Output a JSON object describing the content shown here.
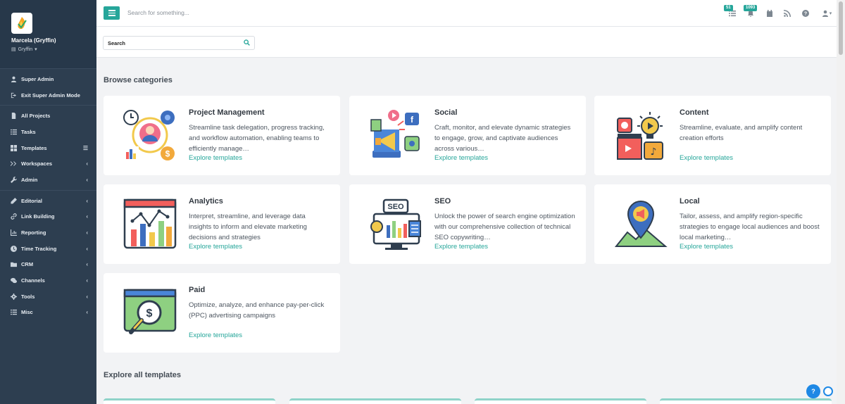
{
  "user": {
    "name": "Marcela (Gryffin)",
    "org": "Gryffin"
  },
  "sidebar": {
    "group1": [
      {
        "label": "Super Admin",
        "icon": "user-icon"
      },
      {
        "label": "Exit Super Admin Mode",
        "icon": "exit-icon"
      }
    ],
    "group2": [
      {
        "label": "All Projects",
        "icon": "file-icon"
      },
      {
        "label": "Tasks",
        "icon": "list-icon"
      },
      {
        "label": "Templates",
        "icon": "table-icon"
      },
      {
        "label": "Workspaces",
        "icon": "double-chevron-icon"
      },
      {
        "label": "Admin",
        "icon": "wrench-icon"
      }
    ],
    "group3": [
      {
        "label": "Editorial",
        "icon": "pencil-icon"
      },
      {
        "label": "Link Building",
        "icon": "link-icon"
      },
      {
        "label": "Reporting",
        "icon": "chart-icon"
      },
      {
        "label": "Time Tracking",
        "icon": "clock-icon"
      },
      {
        "label": "CRM",
        "icon": "folder-icon"
      },
      {
        "label": "Channels",
        "icon": "comments-icon"
      },
      {
        "label": "Tools",
        "icon": "cog-icon"
      },
      {
        "label": "Misc",
        "icon": "list-icon"
      }
    ]
  },
  "topbar": {
    "search_placeholder": "Search for something...",
    "tasks_badge": "51",
    "notifications_badge": "1093"
  },
  "search": {
    "label": "Search"
  },
  "main": {
    "browse_title": "Browse categories",
    "explore_title": "Explore all templates",
    "explore_link": "Explore templates",
    "categories": [
      {
        "title": "Project Management",
        "desc": "Streamline task delegation, progress tracking, and workflow automation, enabling teams to efficiently manage…"
      },
      {
        "title": "Social",
        "desc": "Craft, monitor, and elevate dynamic strategies to engage, grow, and captivate audiences across various…"
      },
      {
        "title": "Content",
        "desc": "Streamline, evaluate, and amplify content creation efforts"
      },
      {
        "title": "Analytics",
        "desc": "Interpret, streamline, and leverage data insights to inform and elevate marketing decisions and strategies"
      },
      {
        "title": "SEO",
        "desc": "Unlock the power of search engine optimization with our comprehensive collection of technical SEO copywriting…"
      },
      {
        "title": "Local",
        "desc": "Tailor, assess, and amplify region-specific strategies to engage local audiences and boost local marketing…"
      },
      {
        "title": "Paid",
        "desc": "Optimize, analyze, and enhance pay-per-click (PPC) advertising campaigns"
      }
    ]
  },
  "colors": {
    "accent": "#26a69a",
    "sidebar": "#2d3e50",
    "fab": "#1e88e5"
  }
}
